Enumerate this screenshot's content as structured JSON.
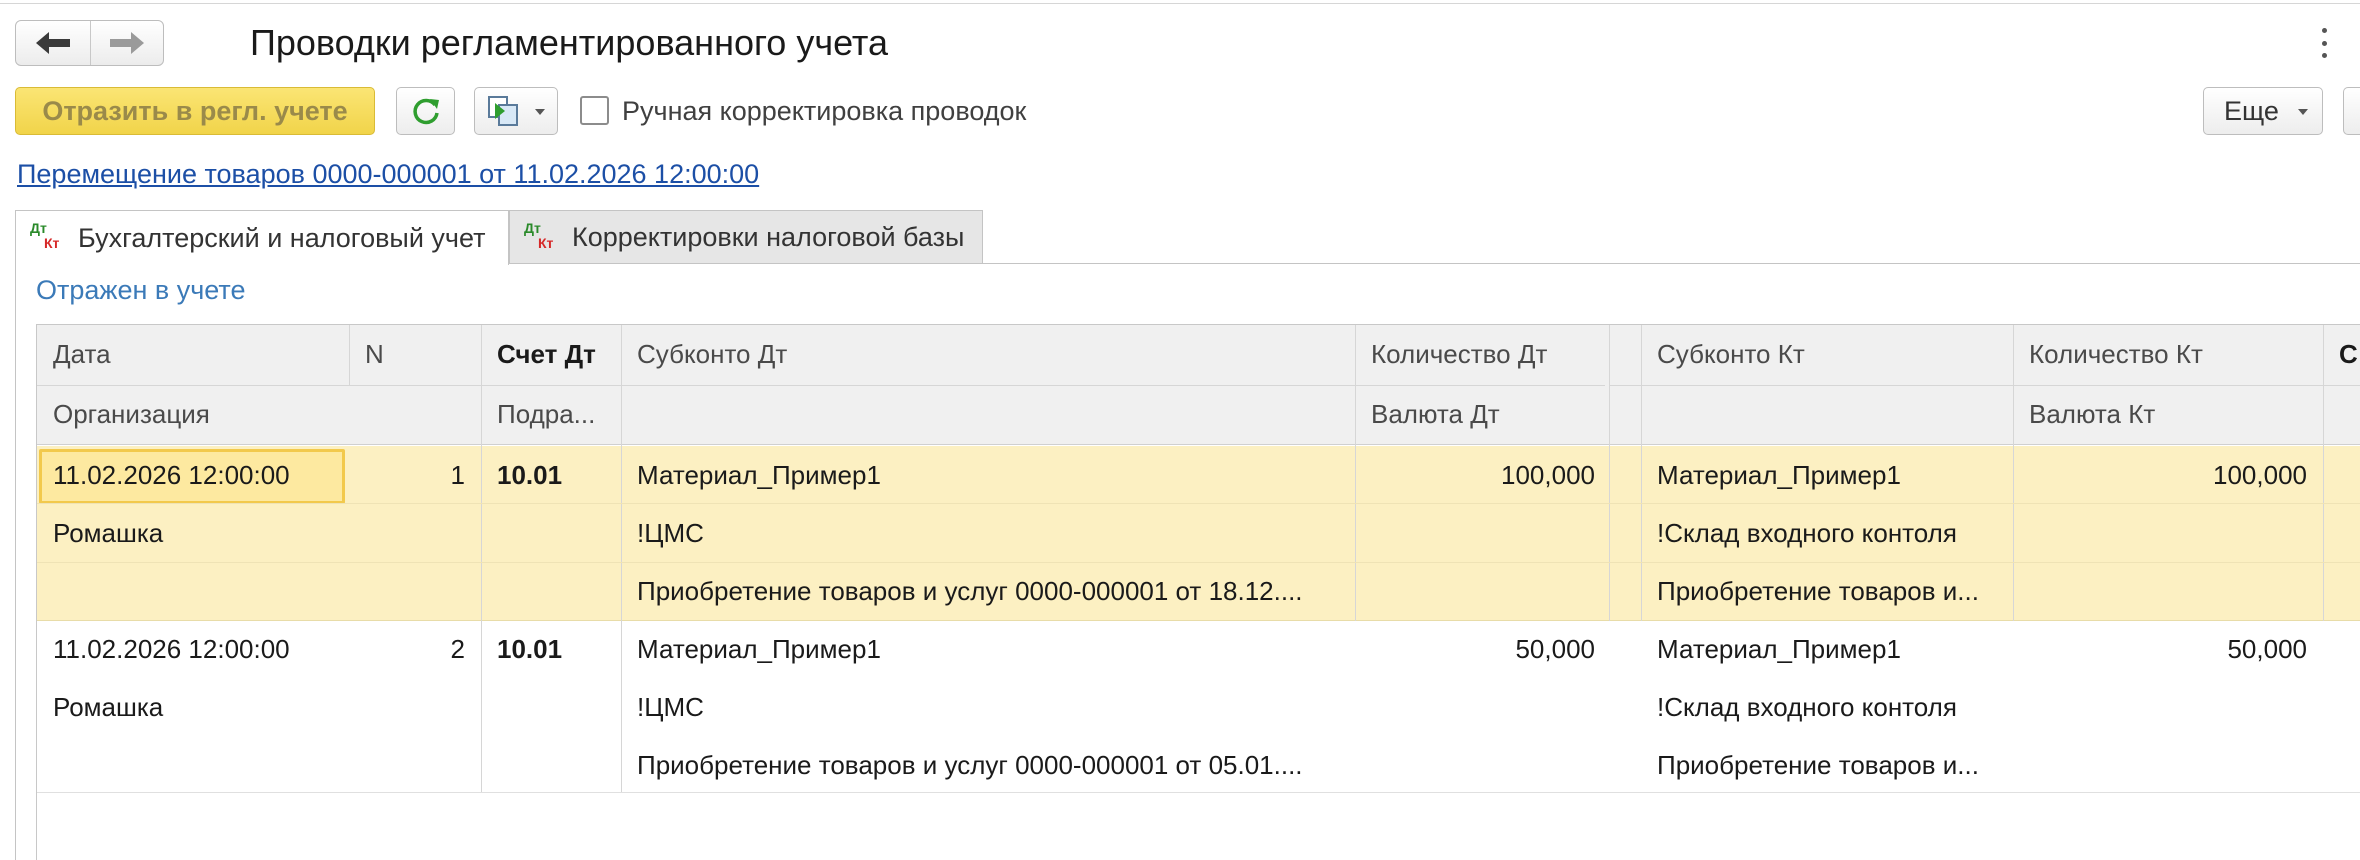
{
  "window": {
    "title": "Проводки регламентированного учета"
  },
  "toolbar": {
    "post_label": "Отразить в регл. учете",
    "manual_checkbox_label": "Ручная корректировка проводок",
    "manual_checked": false,
    "more_label": "Еще"
  },
  "document_link": "Перемещение товаров 0000-000001 от 11.02.2026 12:00:00",
  "tabs": [
    {
      "label": "Бухгалтерский и налоговый учет",
      "active": true
    },
    {
      "label": "Корректировки налоговой базы",
      "active": false
    }
  ],
  "tab_icon": {
    "dt": "Дт",
    "kt": "Кт"
  },
  "status": "Отражен в учете",
  "table": {
    "headers": {
      "date": "Дата",
      "n": "N",
      "account_dt": "Счет Дт",
      "subconto_dt": "Субконто Дт",
      "qty_dt": "Количество Дт",
      "subconto_kt": "Субконто Кт",
      "qty_kt": "Количество Кт",
      "org": "Организация",
      "division": "Подра...",
      "currency_dt": "Валюта Дт",
      "currency_kt": "Валюта Кт",
      "cut_col": "С"
    },
    "rows": [
      {
        "date": "11.02.2026 12:00:00",
        "n": "1",
        "org": "Ромашка",
        "account_dt": "10.01",
        "subconto_dt": [
          "Материал_Пример1",
          "!ЦМС",
          "Приобретение товаров и услуг 0000-000001 от 18.12...."
        ],
        "qty_dt": "100,000",
        "subconto_kt": [
          "Материал_Пример1",
          "!Склад входного контоля",
          "Приобретение товаров и..."
        ],
        "qty_kt": "100,000",
        "selected": true
      },
      {
        "date": "11.02.2026 12:00:00",
        "n": "2",
        "org": "Ромашка",
        "account_dt": "10.01",
        "subconto_dt": [
          "Материал_Пример1",
          "!ЦМС",
          "Приобретение товаров и услуг 0000-000001 от 05.01...."
        ],
        "qty_dt": "50,000",
        "subconto_kt": [
          "Материал_Пример1",
          "!Склад входного контоля",
          "Приобретение товаров и..."
        ],
        "qty_kt": "50,000",
        "selected": false
      }
    ]
  },
  "colors": {
    "accent_button": "#f1d44a",
    "selected_row": "#fcf0c2",
    "link": "#1c4fa6",
    "status_text": "#3b7ab8"
  },
  "icons": {
    "back": "arrow-left-icon",
    "forward": "arrow-right-icon",
    "refresh": "refresh-icon",
    "report": "report-structure-icon",
    "more_menu": "vertical-dots-icon"
  }
}
